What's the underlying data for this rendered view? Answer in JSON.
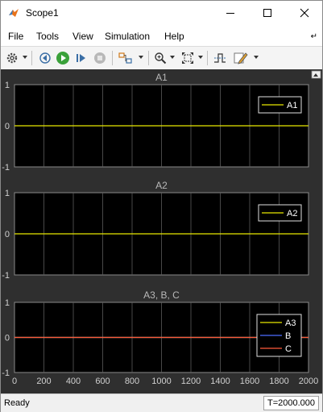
{
  "window": {
    "title": "Scope1"
  },
  "menu": [
    "File",
    "Tools",
    "View",
    "Simulation",
    "Help"
  ],
  "status": {
    "text": "Ready",
    "time": "T=2000.000"
  },
  "colors": {
    "figure_bg": "#2f2f2f",
    "axes_bg": "#000000",
    "grid": "#5a5a5a",
    "yellow": "#e8e800",
    "blue": "#4d6dff",
    "red": "#ff5a3a"
  },
  "chart_data": [
    {
      "type": "line",
      "title": "A1",
      "xlim": [
        0,
        2000
      ],
      "ylim": [
        -1,
        1
      ],
      "yticks": [
        "-1",
        "0",
        "1"
      ],
      "grid": true,
      "legend_position": "top-right",
      "series": [
        {
          "name": "A1",
          "color": "#e8e800",
          "x": [
            0,
            2000
          ],
          "y": [
            0,
            0
          ]
        }
      ]
    },
    {
      "type": "line",
      "title": "A2",
      "xlim": [
        0,
        2000
      ],
      "ylim": [
        -1,
        1
      ],
      "yticks": [
        "-1",
        "0",
        "1"
      ],
      "grid": true,
      "legend_position": "top-right",
      "series": [
        {
          "name": "A2",
          "color": "#e8e800",
          "x": [
            0,
            2000
          ],
          "y": [
            0,
            0
          ]
        }
      ]
    },
    {
      "type": "line",
      "title": "A3, B, C",
      "xlim": [
        0,
        2000
      ],
      "ylim": [
        -1,
        1
      ],
      "yticks": [
        "-1",
        "0",
        "1"
      ],
      "xticks": [
        "0",
        "200",
        "400",
        "600",
        "800",
        "1000",
        "1200",
        "1400",
        "1600",
        "1800",
        "2000"
      ],
      "grid": true,
      "legend_position": "top-right",
      "series": [
        {
          "name": "A3",
          "color": "#e8e800",
          "x": [
            0,
            2000
          ],
          "y": [
            0,
            0
          ]
        },
        {
          "name": "B",
          "color": "#4d6dff",
          "x": [
            0,
            2000
          ],
          "y": [
            0,
            0
          ]
        },
        {
          "name": "C",
          "color": "#ff5a3a",
          "x": [
            0,
            2000
          ],
          "y": [
            0,
            0
          ]
        }
      ]
    }
  ]
}
